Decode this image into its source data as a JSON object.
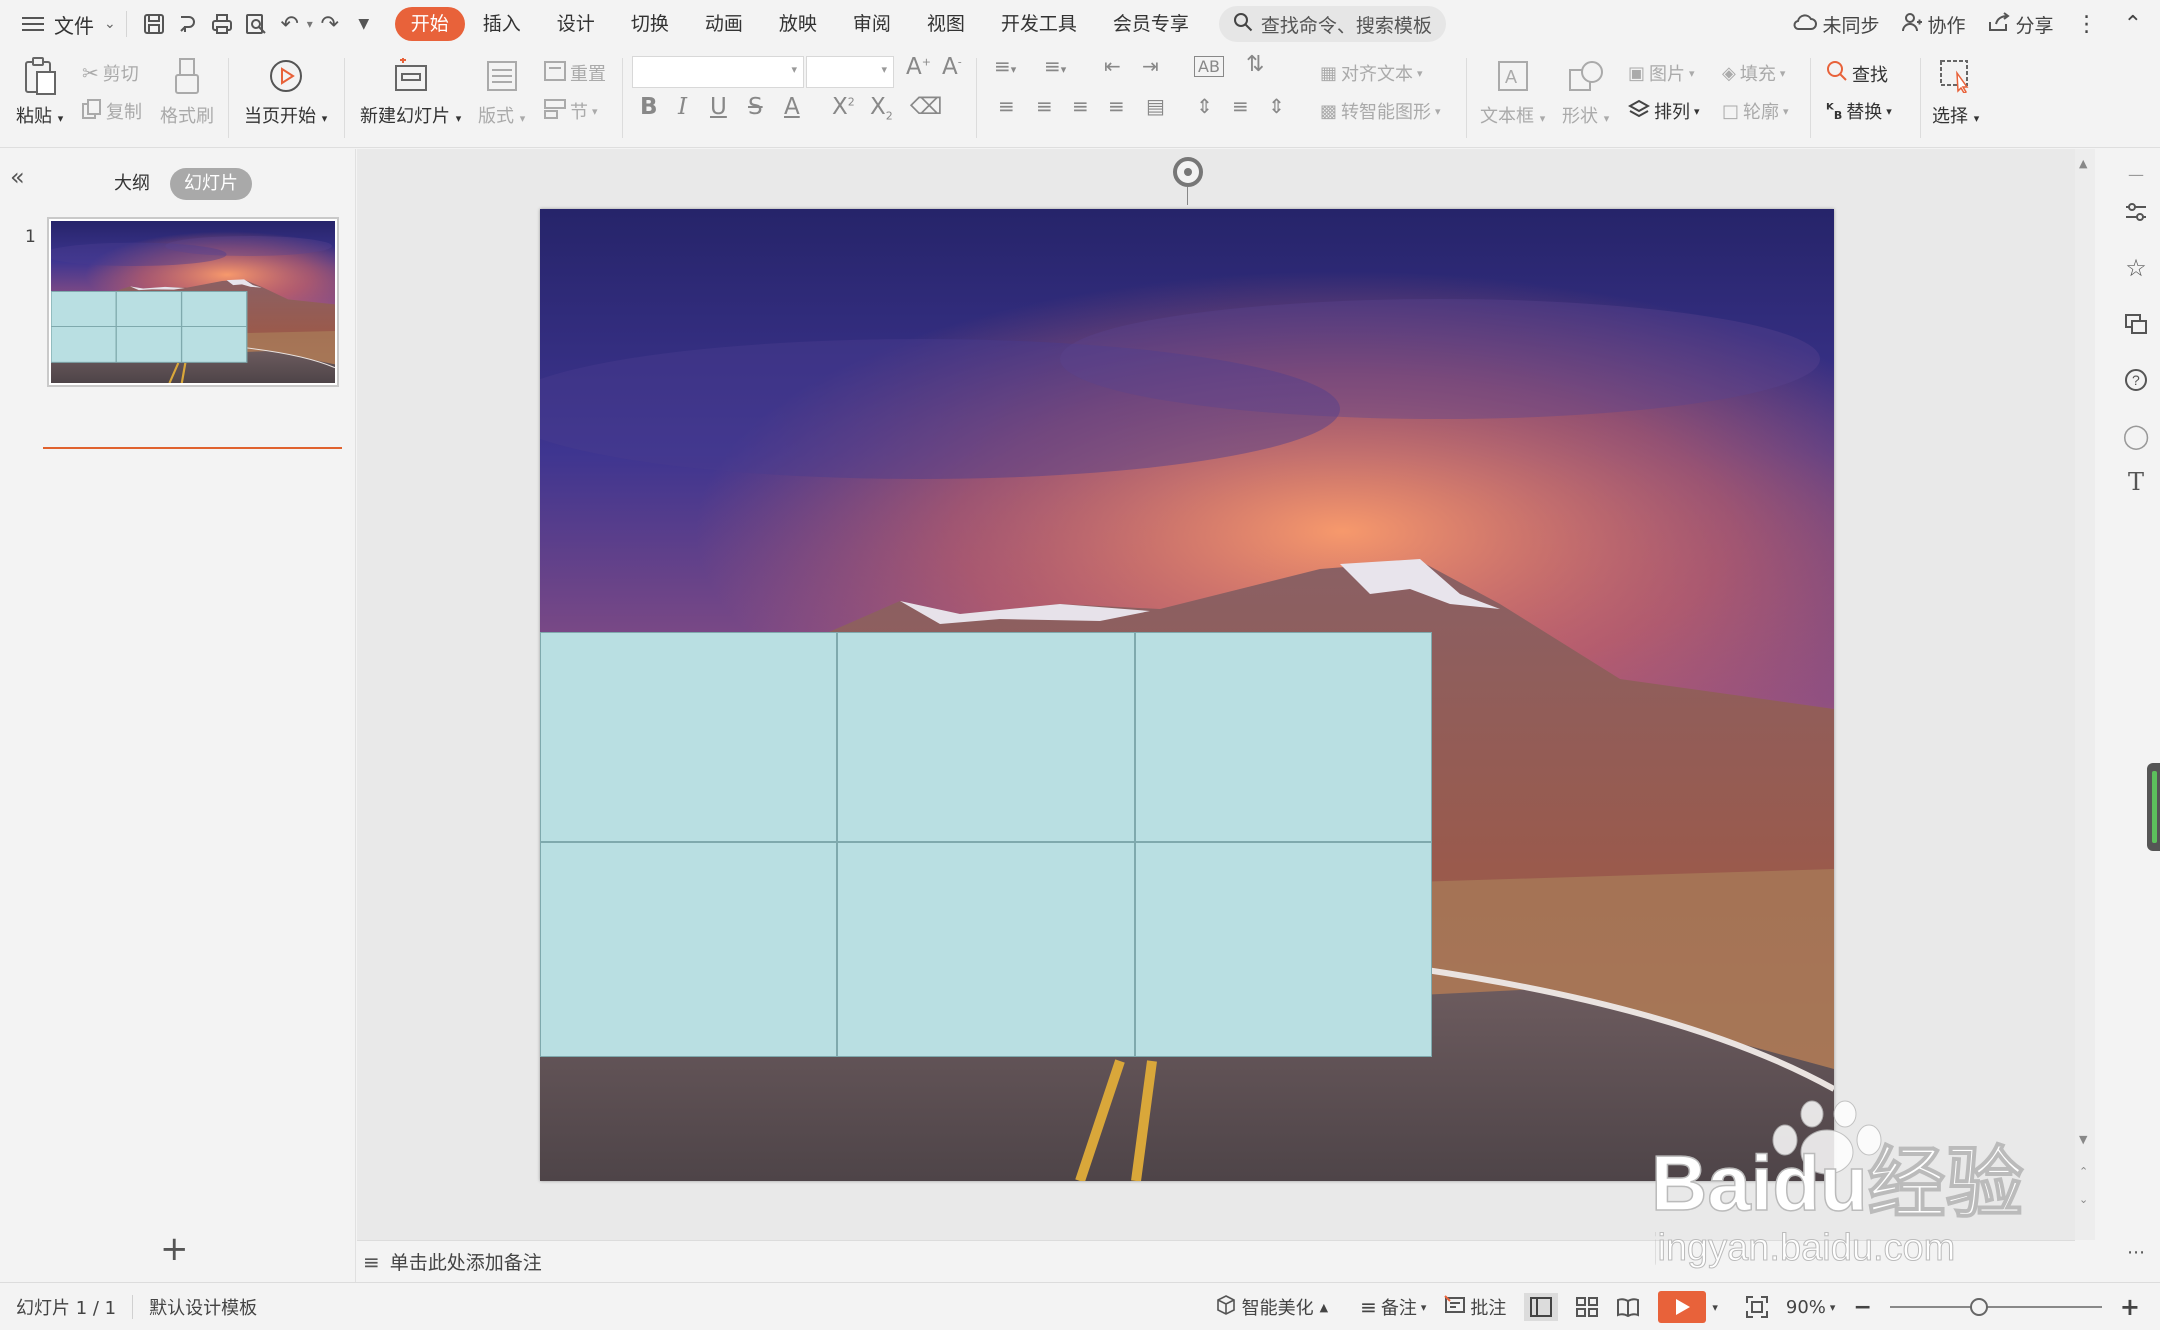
{
  "menubar": {
    "file_label": "文件",
    "tabs": [
      "开始",
      "插入",
      "设计",
      "切换",
      "动画",
      "放映",
      "审阅",
      "视图",
      "开发工具",
      "会员专享"
    ],
    "active_tab": "开始",
    "search_placeholder": "查找命令、搜索模板",
    "sync_label": "未同步",
    "collab_label": "协作",
    "share_label": "分享"
  },
  "ribbon": {
    "paste": "粘贴",
    "cut": "剪切",
    "copy": "复制",
    "format_painter": "格式刷",
    "from_current": "当页开始",
    "new_slide": "新建幻灯片",
    "layout": "版式",
    "reset": "重置",
    "section": "节",
    "align_text": "对齐文本",
    "smart_shape": "转智能图形",
    "textbox": "文本框",
    "shape": "形状",
    "picture": "图片",
    "fill": "填充",
    "arrange": "排列",
    "outline": "轮廓",
    "find": "查找",
    "replace": "替换",
    "select": "选择"
  },
  "leftpanel": {
    "tab_outline": "大纲",
    "tab_slides": "幻灯片",
    "slide_number": "1"
  },
  "notes_placeholder": "单击此处添加备注",
  "statusbar": {
    "slide_info": "幻灯片 1 / 1",
    "template": "默认设计模板",
    "smart_beautify": "智能美化",
    "notes": "备注",
    "comments": "批注",
    "zoom": "90%"
  },
  "watermark": {
    "brand": "Baidu经验",
    "url": "jingyan.baidu.com"
  },
  "colors": {
    "accent": "#e8623a",
    "table_fill": "#b9dfe2",
    "table_border": "#7fa9ad"
  }
}
